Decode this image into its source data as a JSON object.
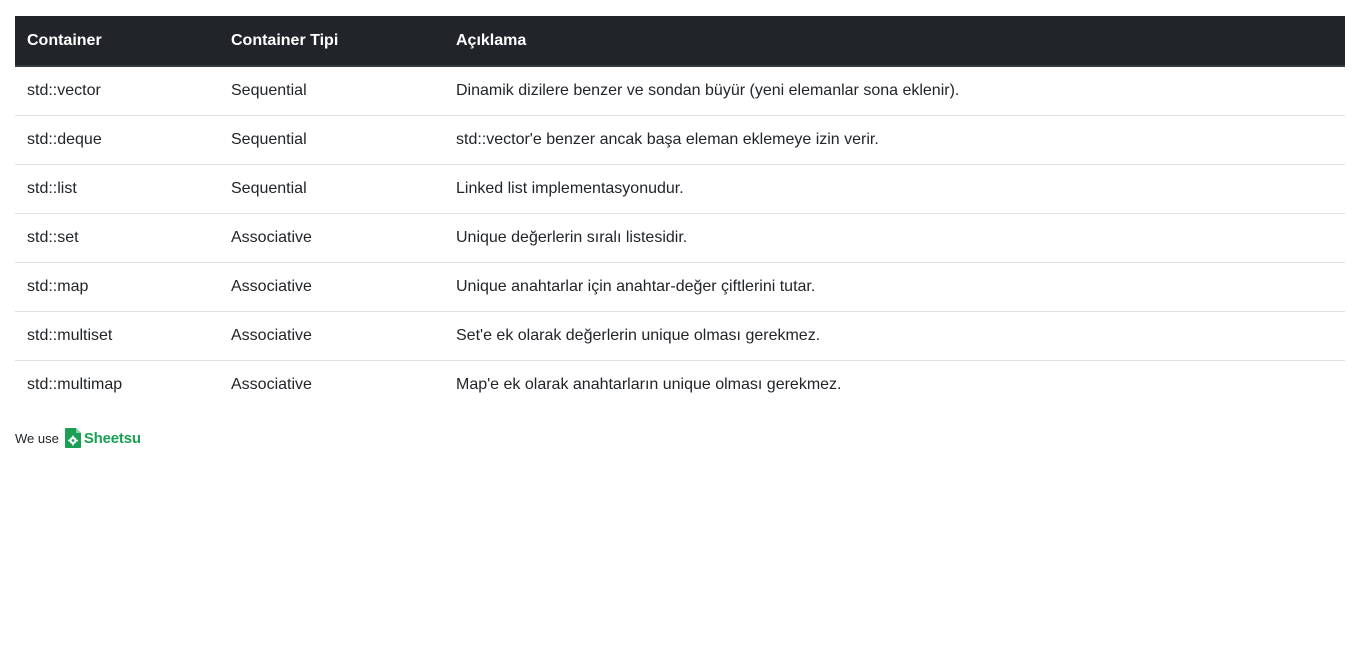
{
  "table": {
    "headers": [
      "Container",
      "Container Tipi",
      "Açıklama"
    ],
    "rows": [
      [
        "std::vector",
        "Sequential",
        "Dinamik dizilere benzer ve sondan büyür (yeni elemanlar sona eklenir)."
      ],
      [
        "std::deque",
        "Sequential",
        "std::vector'e benzer ancak başa eleman eklemeye izin verir."
      ],
      [
        "std::list",
        "Sequential",
        "Linked list implementasyonudur."
      ],
      [
        "std::set",
        "Associative",
        "Unique değerlerin sıralı listesidir."
      ],
      [
        "std::map",
        "Associative",
        "Unique anahtarlar için anahtar-değer çiftlerini tutar."
      ],
      [
        "std::multiset",
        "Associative",
        "Set'e ek olarak değerlerin unique olması gerekmez."
      ],
      [
        "std::multimap",
        "Associative",
        "Map'e ek olarak anahtarların unique olması gerekmez."
      ]
    ]
  },
  "footer": {
    "prefix": "We use",
    "brand": "Sheetsu",
    "brand_icon": "sheetsu-logo-icon",
    "brand_color": "#1a9f54"
  },
  "colors": {
    "header_bg": "#212529",
    "header_text": "#ffffff",
    "row_border": "#dee2e6"
  }
}
